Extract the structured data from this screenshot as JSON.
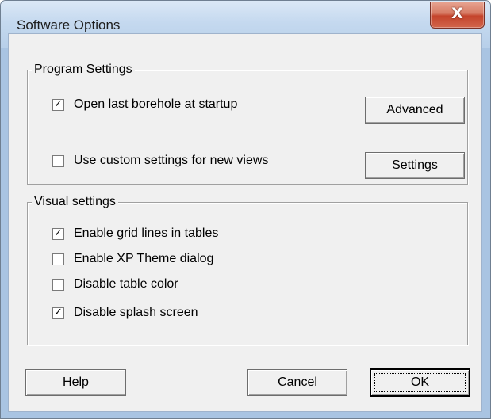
{
  "window": {
    "title": "Software Options",
    "close_glyph": "X"
  },
  "program_settings": {
    "label": "Program Settings",
    "open_last_borehole": {
      "label": "Open last borehole at startup",
      "checked": true
    },
    "custom_settings": {
      "label": "Use custom settings for new views",
      "checked": false
    },
    "advanced_button": "Advanced",
    "settings_button": "Settings"
  },
  "visual_settings": {
    "label": "Visual settings",
    "items": [
      {
        "label": "Enable grid lines in tables",
        "checked": true
      },
      {
        "label": "Enable XP Theme dialog",
        "checked": false
      },
      {
        "label": "Disable table color",
        "checked": false
      },
      {
        "label": "Disable splash screen",
        "checked": true
      }
    ]
  },
  "footer": {
    "help": "Help",
    "cancel": "Cancel",
    "ok": "OK"
  },
  "check_glyph": "✓"
}
